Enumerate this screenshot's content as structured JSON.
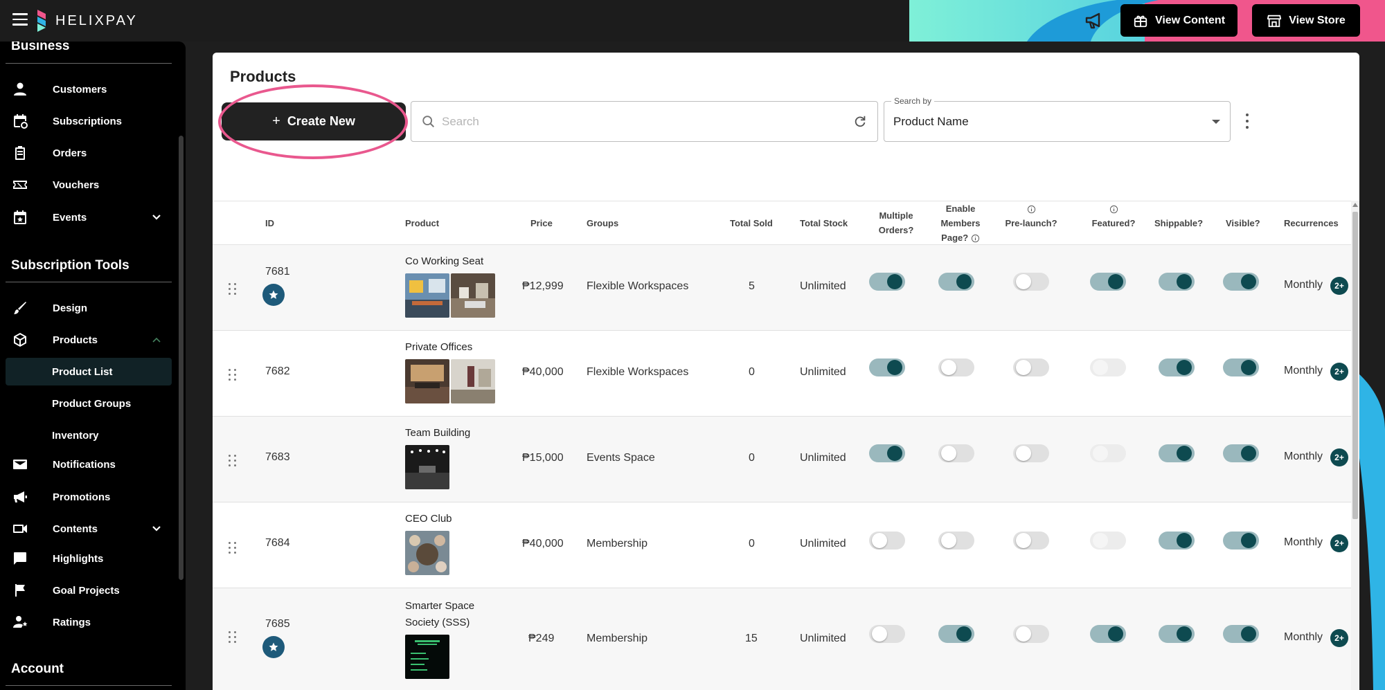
{
  "brand": {
    "name": "HELIXPAY"
  },
  "header": {
    "view_content": "View Content",
    "view_store": "View Store"
  },
  "sidebar": {
    "section_business": "Business",
    "section_subscription_tools": "Subscription Tools",
    "section_account": "Account",
    "items": {
      "customers": "Customers",
      "subscriptions": "Subscriptions",
      "orders": "Orders",
      "vouchers": "Vouchers",
      "events": "Events",
      "design": "Design",
      "products": "Products",
      "product_list": "Product List",
      "product_groups": "Product Groups",
      "inventory": "Inventory",
      "notifications": "Notifications",
      "promotions": "Promotions",
      "contents": "Contents",
      "highlights": "Highlights",
      "goal_projects": "Goal Projects",
      "ratings": "Ratings"
    }
  },
  "page": {
    "title": "Products",
    "create_new": "Create New",
    "search_placeholder": "Search",
    "search_by_label": "Search by",
    "search_by_value": "Product Name"
  },
  "table": {
    "headers": {
      "id": "ID",
      "product": "Product",
      "price": "Price",
      "groups": "Groups",
      "total_sold": "Total Sold",
      "total_stock": "Total Stock",
      "multiple_orders_1": "Multiple",
      "multiple_orders_2": "Orders?",
      "members_1": "Enable",
      "members_2": "Members",
      "members_3": "Page?",
      "prelaunch": "Pre-launch?",
      "featured": "Featured?",
      "shippable": "Shippable?",
      "visible": "Visible?",
      "recurrences": "Recurrences"
    },
    "rows": [
      {
        "id": "7681",
        "name": "Co Working Seat",
        "price": "₱12,999",
        "group": "Flexible Workspaces",
        "sold": "5",
        "stock": "Unlimited",
        "recurrence": "Monthly",
        "badge": "2+",
        "starred": true,
        "multiple_orders": "on",
        "members_page": "on",
        "prelaunch": "off",
        "featured": "on",
        "shippable": "on",
        "visible": "on"
      },
      {
        "id": "7682",
        "name": "Private Offices",
        "price": "₱40,000",
        "group": "Flexible Workspaces",
        "sold": "0",
        "stock": "Unlimited",
        "recurrence": "Monthly",
        "badge": "2+",
        "starred": false,
        "multiple_orders": "on",
        "members_page": "off",
        "prelaunch": "off",
        "featured": "disabled",
        "shippable": "on",
        "visible": "on"
      },
      {
        "id": "7683",
        "name": "Team Building",
        "price": "₱15,000",
        "group": "Events Space",
        "sold": "0",
        "stock": "Unlimited",
        "recurrence": "Monthly",
        "badge": "2+",
        "starred": false,
        "multiple_orders": "on",
        "members_page": "off",
        "prelaunch": "off",
        "featured": "disabled",
        "shippable": "on",
        "visible": "on"
      },
      {
        "id": "7684",
        "name": "CEO Club",
        "price": "₱40,000",
        "group": "Membership",
        "sold": "0",
        "stock": "Unlimited",
        "recurrence": "Monthly",
        "badge": "2+",
        "starred": false,
        "multiple_orders": "off",
        "members_page": "off",
        "prelaunch": "off",
        "featured": "disabled",
        "shippable": "on",
        "visible": "on"
      },
      {
        "id": "7685",
        "name_line1": "Smarter Space",
        "name_line2": "Society (SSS)",
        "price": "₱249",
        "group": "Membership",
        "sold": "15",
        "stock": "Unlimited",
        "recurrence": "Monthly",
        "badge": "2+",
        "starred": true,
        "multiple_orders": "off",
        "members_page": "on",
        "prelaunch": "off",
        "featured": "on",
        "shippable": "on",
        "visible": "on"
      }
    ]
  },
  "colors": {
    "accent_teal": "#0e4a50",
    "toggle_track_on": "#9ab8bd",
    "highlight_pink": "#e9588e",
    "star_blue": "#1e5a7a"
  }
}
